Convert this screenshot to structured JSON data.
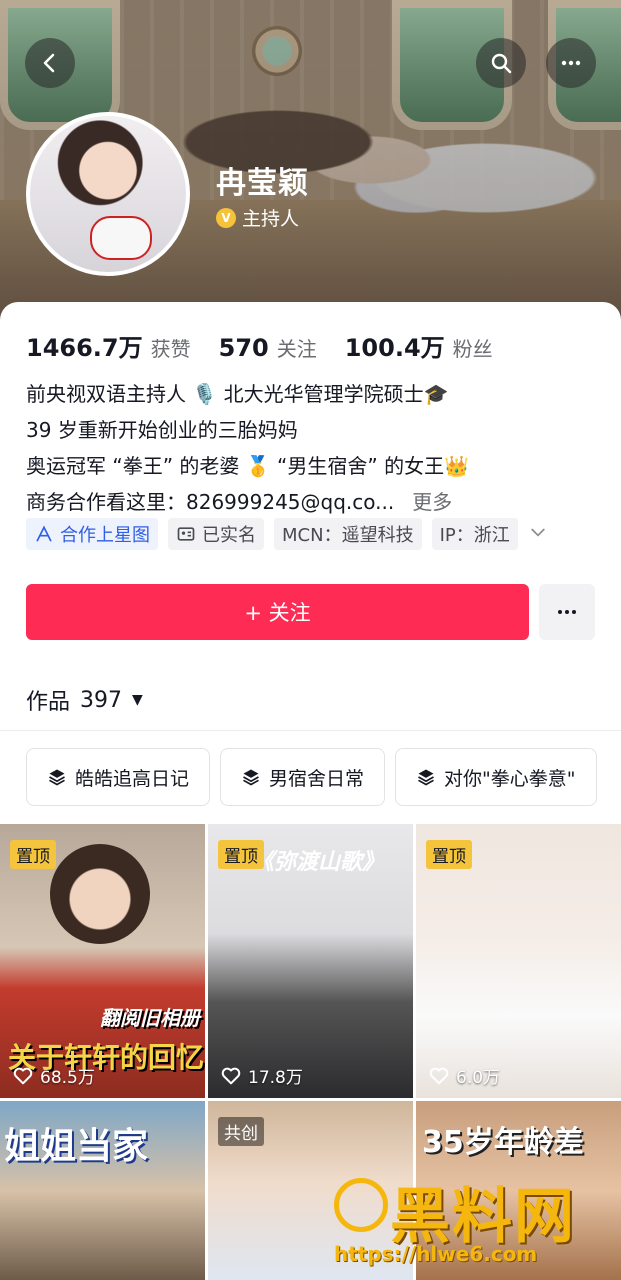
{
  "profile": {
    "name": "冉莹颖",
    "verify_label": "主持人"
  },
  "stats": [
    {
      "num": "1466.7万",
      "label": "获赞"
    },
    {
      "num": "570",
      "label": "关注"
    },
    {
      "num": "100.4万",
      "label": "粉丝"
    }
  ],
  "bio": {
    "line1": "前央视双语主持人 🎙️ 北大光华管理学院硕士🎓",
    "line2": "39 岁重新开始创业的三胎妈妈",
    "line3": "奥运冠军 “拳王” 的老婆 🥇 “男生宿舍” 的女王👑",
    "line4": " 商务合作看这里：826999245@qq.co...",
    "more": "更多"
  },
  "tags": {
    "star": "合作上星图",
    "realname": "已实名",
    "mcn": "MCN：遥望科技",
    "ip": "IP：浙江"
  },
  "follow_label": "+ 关注",
  "works": {
    "label": "作品",
    "count": "397"
  },
  "albums": [
    "皓皓追高日记",
    "男宿舍日常",
    "对你\"拳心拳意\""
  ],
  "videos": [
    {
      "badge": "置顶",
      "likes": "68.5万",
      "caption": "关于轩轩的回忆",
      "subcaption": "翻阅旧相册"
    },
    {
      "badge": "置顶",
      "likes": "17.8万",
      "caption": "《弥渡山歌》"
    },
    {
      "badge": "置顶",
      "likes": "6.0万"
    },
    {
      "caption": "姐姐当家"
    },
    {
      "badge": "共创"
    },
    {
      "caption": "35岁年龄差"
    }
  ],
  "watermark": {
    "main": "黑料网",
    "url": "https://hlwe6.com"
  },
  "colors": {
    "primary": "#fe2c55",
    "pin_badge": "#f3c43c",
    "star_tag": "#2f5fe4"
  }
}
